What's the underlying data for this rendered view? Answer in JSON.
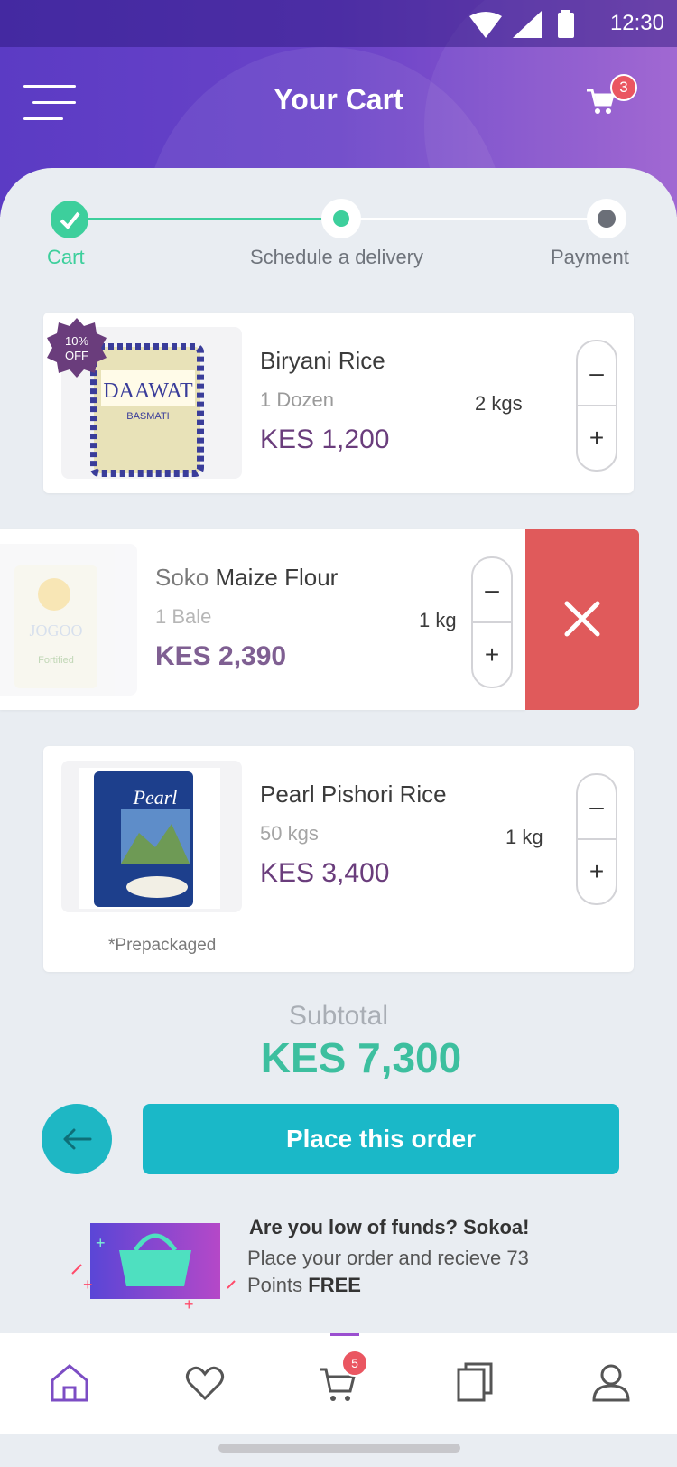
{
  "status_bar": {
    "time": "12:30"
  },
  "header": {
    "title": "Your Cart",
    "cart_count": "3"
  },
  "steps": [
    {
      "label": "Cart",
      "state": "done"
    },
    {
      "label": "Schedule a delivery",
      "state": "active"
    },
    {
      "label": "Payment",
      "state": "pending"
    }
  ],
  "items": [
    {
      "badge": "10%\nOFF",
      "badge_line1": "10%",
      "badge_line2": "OFF",
      "brand": "",
      "name": "Biryani Rice",
      "qty": "1 Dozen",
      "price": "KES 1,200",
      "weight": "2 kgs",
      "thumb_text": "DAAWAT",
      "thumb_sub": "BASMATI"
    },
    {
      "brand": "Soko",
      "name": "Maize Flour",
      "qty": "1 Bale",
      "price": "KES 2,390",
      "weight": "1 kg",
      "thumb_text": "JOGOO",
      "thumb_sub": "Fortified"
    },
    {
      "brand": "",
      "name": "Pearl Pishori Rice",
      "qty": "50 kgs",
      "price": "KES 3,400",
      "weight": "1 kg",
      "thumb_text": "Pearl",
      "note": "*Prepackaged"
    }
  ],
  "stepper": {
    "minus": "–",
    "plus": "+"
  },
  "subtotal": {
    "label": "Subtotal",
    "value": "KES 7,300"
  },
  "actions": {
    "place_order": "Place this order"
  },
  "promo": {
    "title": "Are you low of funds? Sokoa!",
    "line1": "Place your order and recieve 73",
    "line2_prefix": "Points ",
    "line2_bold": "FREE"
  },
  "nav": {
    "cart_badge": "5"
  },
  "colors": {
    "accent": "#1ab8c8",
    "purple": "#6a3d7c",
    "green": "#3dbf9f",
    "delete": "#e05a5b"
  }
}
